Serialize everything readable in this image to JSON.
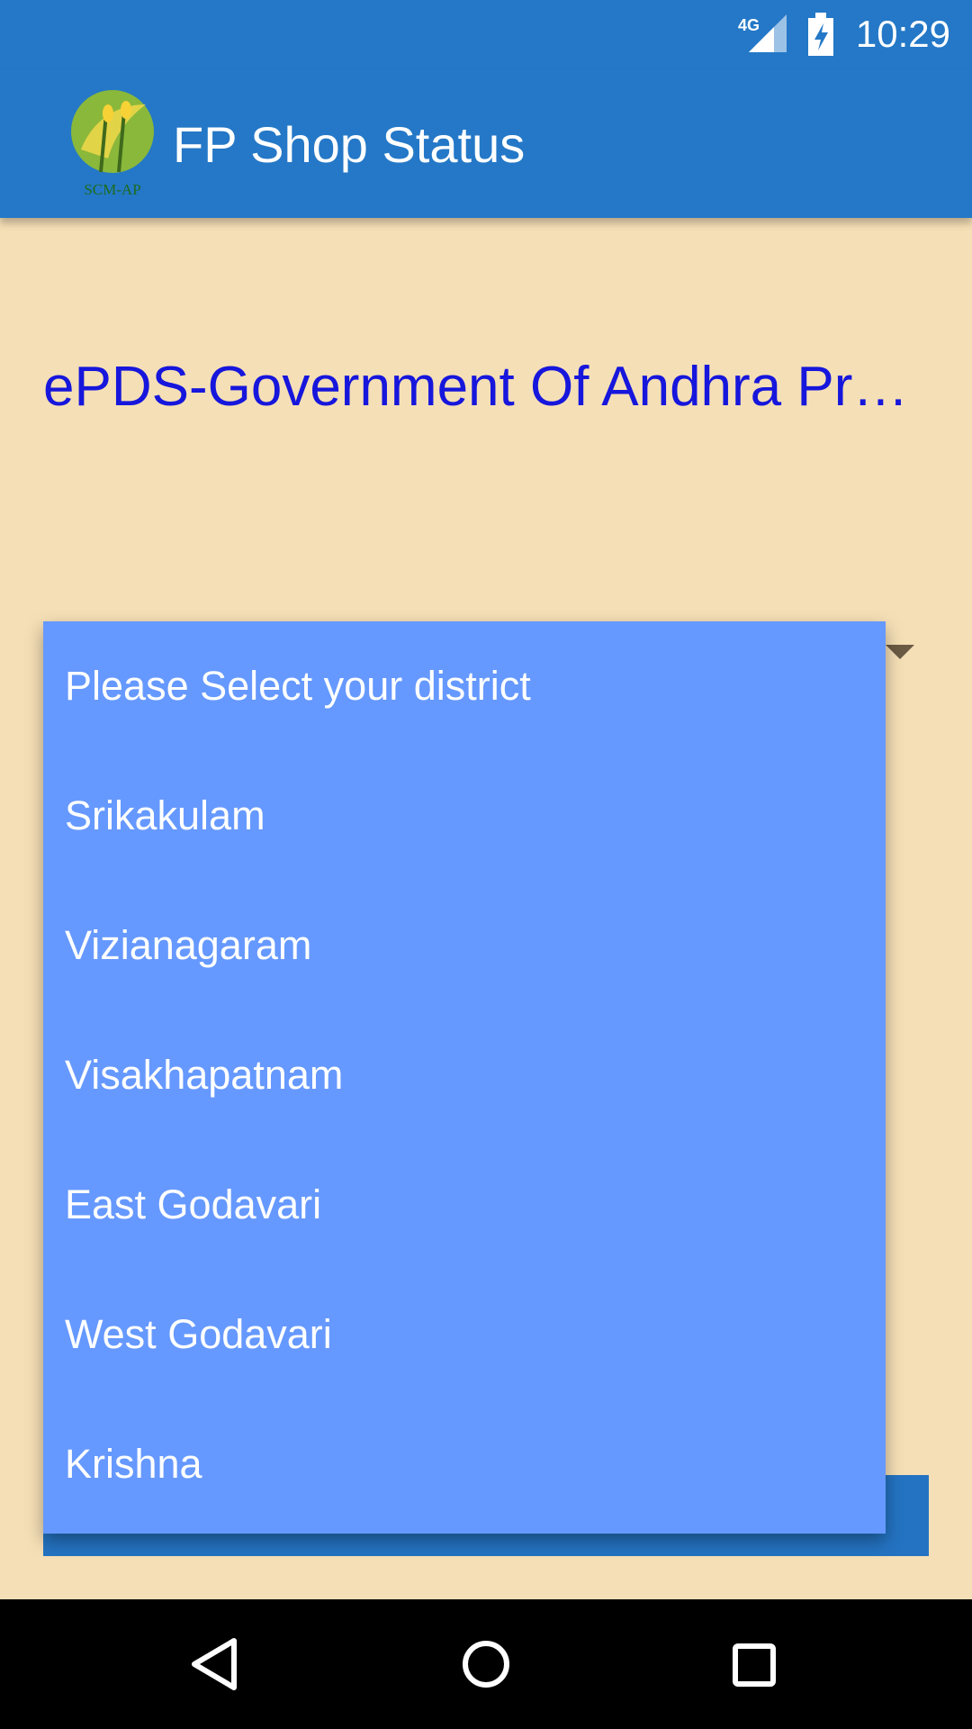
{
  "status_bar": {
    "time": "10:29",
    "network": "4G",
    "signal_icon": "signal-icon",
    "battery_icon": "battery-charging-icon"
  },
  "app_bar": {
    "title": "FP Shop Status",
    "logo_text": "SCM-AP"
  },
  "main": {
    "heading": "ePDS-Government Of Andhra Pr…"
  },
  "dropdown": {
    "options": [
      "Please Select your district",
      "Srikakulam",
      "Vizianagaram",
      "Visakhapatnam",
      "East Godavari",
      "West Godavari",
      "Krishna"
    ]
  },
  "nav": {
    "back_icon": "back-icon",
    "home_icon": "home-icon",
    "recents_icon": "recents-icon"
  },
  "colors": {
    "primary": "#2478c7",
    "background": "#f5dfb6",
    "dropdown": "#6699ff",
    "heading": "#1616dc"
  }
}
